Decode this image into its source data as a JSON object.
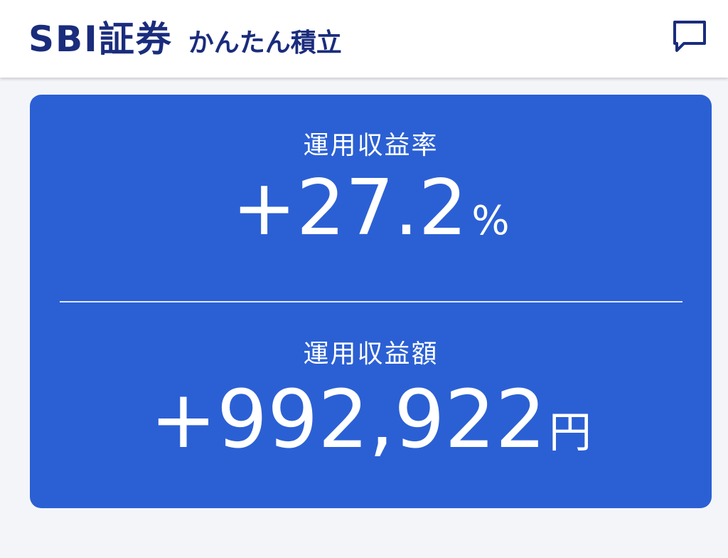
{
  "header": {
    "logo_text": "SBI証券",
    "product_name": "かんたん積立",
    "chat_icon": "chat-bubble-icon",
    "brand_color": "#1a2c7c"
  },
  "card": {
    "background_color": "#2b60d4",
    "return_rate": {
      "label": "運用収益率",
      "value": "+27.2",
      "unit": "%"
    },
    "return_amount": {
      "label": "運用収益額",
      "value": "+992,922",
      "unit": "円"
    }
  }
}
